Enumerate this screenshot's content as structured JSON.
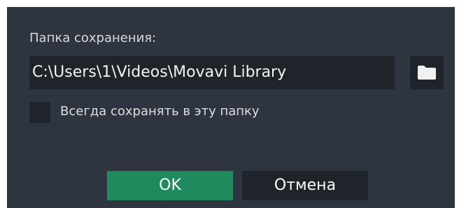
{
  "dialog": {
    "folder_label": "Папка сохранения:",
    "path_value": "C:\\Users\\1\\Videos\\Movavi Library",
    "browse_icon": "folder-icon",
    "always_save_label": "Всегда сохранять в эту папку",
    "always_save_checked": false,
    "ok_label": "OK",
    "cancel_label": "Отмена"
  },
  "colors": {
    "dialog_background": "#2e3440",
    "field_background": "#1f242b",
    "ok_button": "#1f8a5e",
    "text": "#e8e8e8"
  }
}
